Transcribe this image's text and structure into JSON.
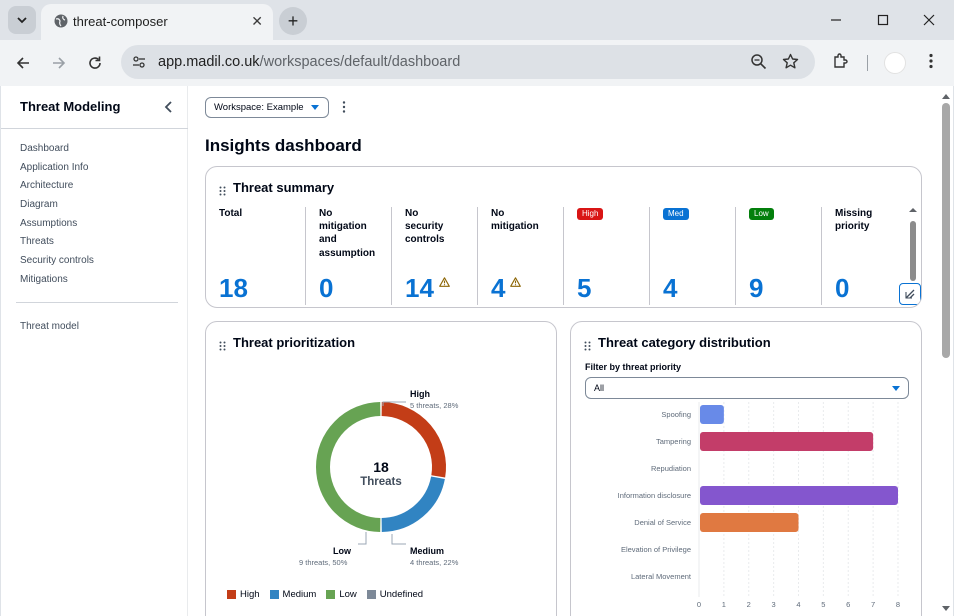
{
  "browser": {
    "tab_title": "threat-composer",
    "url_host": "app.madil.co.uk",
    "url_path": "/workspaces/default/dashboard"
  },
  "sidebar": {
    "title": "Threat Modeling",
    "items": [
      {
        "label": "Dashboard"
      },
      {
        "label": "Application Info"
      },
      {
        "label": "Architecture"
      },
      {
        "label": "Diagram"
      },
      {
        "label": "Assumptions"
      },
      {
        "label": "Threats"
      },
      {
        "label": "Security controls"
      },
      {
        "label": "Mitigations"
      }
    ],
    "secondary_item": "Threat model"
  },
  "header": {
    "workspace_button": "Workspace: Example",
    "page_title": "Insights dashboard"
  },
  "threat_summary": {
    "title": "Threat summary",
    "metrics": [
      {
        "label": "Total",
        "value": "18",
        "warning": false
      },
      {
        "label": "No mitigation and assumption",
        "value": "0",
        "warning": false
      },
      {
        "label": "No security controls",
        "value": "14",
        "warning": true
      },
      {
        "label": "No mitigation",
        "value": "4",
        "warning": true
      },
      {
        "badge": "High",
        "badge_color": "#d91515",
        "value": "5",
        "warning": false
      },
      {
        "badge": "Med",
        "badge_color": "#0972d3",
        "value": "4",
        "warning": false
      },
      {
        "badge": "Low",
        "badge_color": "#037f0c",
        "value": "9",
        "warning": false
      },
      {
        "label": "Missing priority",
        "value": "0",
        "warning": false
      }
    ]
  },
  "prioritization": {
    "title": "Threat prioritization",
    "center_value": "18",
    "center_label": "Threats",
    "segments": [
      {
        "name": "High",
        "value": 5,
        "detail": "5 threats, 28%",
        "color": "#c33d17"
      },
      {
        "name": "Medium",
        "value": 4,
        "detail": "4 threats, 22%",
        "color": "#3184c2"
      },
      {
        "name": "Low",
        "value": 9,
        "detail": "9 threats, 50%",
        "color": "#67a353"
      }
    ],
    "legend": [
      {
        "label": "High",
        "color": "#c33d17"
      },
      {
        "label": "Medium",
        "color": "#3184c2"
      },
      {
        "label": "Low",
        "color": "#67a353"
      },
      {
        "label": "Undefined",
        "color": "#7d8998"
      }
    ]
  },
  "category": {
    "title": "Threat category distribution",
    "filter_label": "Filter by threat priority",
    "filter_value": "All"
  },
  "chart_data": {
    "type": "bar",
    "orientation": "horizontal",
    "categories": [
      "Spoofing",
      "Tampering",
      "Repudiation",
      "Information disclosure",
      "Denial of Service",
      "Elevation of Privilege",
      "Lateral Movement"
    ],
    "values": [
      1,
      7,
      0,
      8,
      4,
      0,
      0
    ],
    "colors": [
      "#688ae8",
      "#c33d69",
      "#2ea597",
      "#8456ce",
      "#e07941",
      "#3759ce",
      "#962249"
    ],
    "xlim": [
      0,
      8
    ],
    "xticks": [
      0,
      1,
      2,
      3,
      4,
      5,
      6,
      7,
      8
    ],
    "grid": true
  }
}
